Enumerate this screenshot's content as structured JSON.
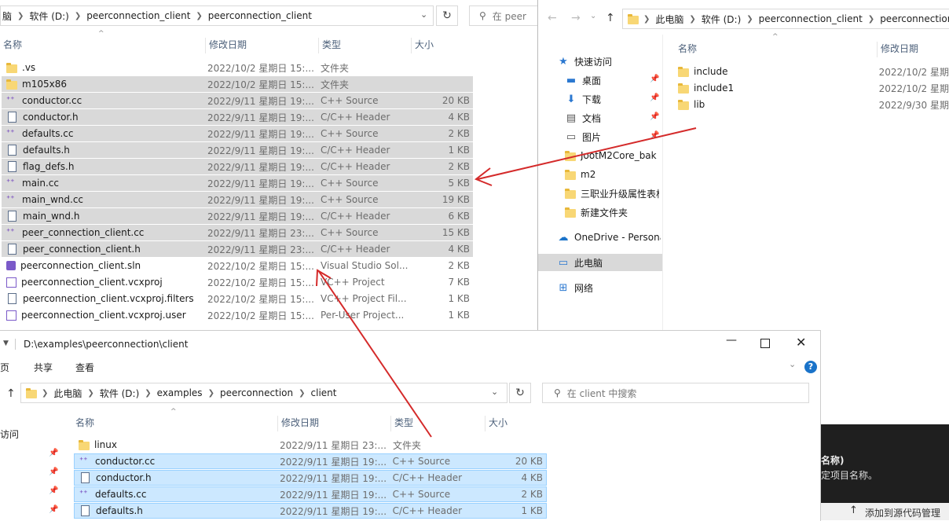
{
  "explorer_main": {
    "breadcrumb": [
      "脑",
      "软件 (D:)",
      "peerconnection_client",
      "peerconnection_client"
    ],
    "search_placeholder": "在 peer",
    "columns": {
      "name": "名称",
      "date": "修改日期",
      "type": "类型",
      "size": "大小"
    },
    "rows": [
      {
        "icon": "folder-icon",
        "name": ".vs",
        "date": "2022/10/2 星期日 15:...",
        "type": "文件夹",
        "size": "",
        "selected": false
      },
      {
        "icon": "folder-icon",
        "name": "m105x86",
        "date": "2022/10/2 星期日 15:...",
        "type": "文件夹",
        "size": "",
        "selected": true
      },
      {
        "icon": "cpp-source-icon",
        "name": "conductor.cc",
        "date": "2022/9/11 星期日 19:...",
        "type": "C++ Source",
        "size": "20 KB",
        "selected": true
      },
      {
        "icon": "header-file-icon",
        "name": "conductor.h",
        "date": "2022/9/11 星期日 19:...",
        "type": "C/C++ Header",
        "size": "4 KB",
        "selected": true
      },
      {
        "icon": "cpp-source-icon",
        "name": "defaults.cc",
        "date": "2022/9/11 星期日 19:...",
        "type": "C++ Source",
        "size": "2 KB",
        "selected": true
      },
      {
        "icon": "header-file-icon",
        "name": "defaults.h",
        "date": "2022/9/11 星期日 19:...",
        "type": "C/C++ Header",
        "size": "1 KB",
        "selected": true
      },
      {
        "icon": "header-file-icon",
        "name": "flag_defs.h",
        "date": "2022/9/11 星期日 19:...",
        "type": "C/C++ Header",
        "size": "2 KB",
        "selected": true
      },
      {
        "icon": "cpp-source-icon",
        "name": "main.cc",
        "date": "2022/9/11 星期日 19:...",
        "type": "C++ Source",
        "size": "5 KB",
        "selected": true
      },
      {
        "icon": "cpp-source-icon",
        "name": "main_wnd.cc",
        "date": "2022/9/11 星期日 19:...",
        "type": "C++ Source",
        "size": "19 KB",
        "selected": true
      },
      {
        "icon": "header-file-icon",
        "name": "main_wnd.h",
        "date": "2022/9/11 星期日 19:...",
        "type": "C/C++ Header",
        "size": "6 KB",
        "selected": true
      },
      {
        "icon": "cpp-source-icon",
        "name": "peer_connection_client.cc",
        "date": "2022/9/11 星期日 23:...",
        "type": "C++ Source",
        "size": "15 KB",
        "selected": true
      },
      {
        "icon": "header-file-icon",
        "name": "peer_connection_client.h",
        "date": "2022/9/11 星期日 23:...",
        "type": "C/C++ Header",
        "size": "4 KB",
        "selected": true
      },
      {
        "icon": "solution-icon",
        "name": "peerconnection_client.sln",
        "date": "2022/10/2 星期日 15:...",
        "type": "Visual Studio Sol...",
        "size": "2 KB",
        "selected": false
      },
      {
        "icon": "project-icon",
        "name": "peerconnection_client.vcxproj",
        "date": "2022/10/2 星期日 15:...",
        "type": "VC++ Project",
        "size": "7 KB",
        "selected": false
      },
      {
        "icon": "filters-icon",
        "name": "peerconnection_client.vcxproj.filters",
        "date": "2022/10/2 星期日 15:...",
        "type": "VC++ Project Fil...",
        "size": "1 KB",
        "selected": false
      },
      {
        "icon": "project-icon",
        "name": "peerconnection_client.vcxproj.user",
        "date": "2022/10/2 星期日 15:...",
        "type": "Per-User Project...",
        "size": "1 KB",
        "selected": false
      }
    ]
  },
  "explorer_right": {
    "breadcrumb": [
      "此电脑",
      "软件 (D:)",
      "peerconnection_client",
      "peerconnection_"
    ],
    "columns": {
      "name": "名称",
      "date": "修改日期"
    },
    "nav": [
      {
        "icon": "star-icon",
        "label": "快速访问",
        "pinned": false
      },
      {
        "icon": "desktop-icon",
        "label": "桌面",
        "pinned": true
      },
      {
        "icon": "download-icon",
        "label": "下载",
        "pinned": true
      },
      {
        "icon": "documents-icon",
        "label": "文档",
        "pinned": true
      },
      {
        "icon": "pictures-icon",
        "label": "图片",
        "pinned": true
      },
      {
        "icon": "folder-icon",
        "label": "JootM2Core_bak",
        "pinned": false
      },
      {
        "icon": "folder-icon",
        "label": "m2",
        "pinned": false
      },
      {
        "icon": "folder-icon",
        "label": "三职业升级属性表格",
        "pinned": false
      },
      {
        "icon": "folder-icon",
        "label": "新建文件夹",
        "pinned": false
      },
      {
        "icon": "onedrive-icon",
        "label": "OneDrive - Personal",
        "pinned": false
      },
      {
        "icon": "computer-icon",
        "label": "此电脑",
        "pinned": false
      },
      {
        "icon": "network-icon",
        "label": "网络",
        "pinned": false
      }
    ],
    "rows": [
      {
        "name": "include",
        "date": "2022/10/2 星期"
      },
      {
        "name": "include1",
        "date": "2022/10/2 星期"
      },
      {
        "name": "lib",
        "date": "2022/9/30 星期"
      }
    ]
  },
  "explorer_bottom": {
    "title": "D:\\examples\\peerconnection\\client",
    "ribbon": [
      "页",
      "共享",
      "查看"
    ],
    "breadcrumb": [
      "此电脑",
      "软件 (D:)",
      "examples",
      "peerconnection",
      "client"
    ],
    "search_placeholder": "在 client 中搜索",
    "columns": {
      "name": "名称",
      "date": "修改日期",
      "type": "类型",
      "size": "大小"
    },
    "nav_label": "访问",
    "rows": [
      {
        "icon": "folder-icon",
        "name": "linux",
        "date": "2022/9/11 星期日 23:...",
        "type": "文件夹",
        "size": "",
        "selected": false
      },
      {
        "icon": "cpp-source-icon",
        "name": "conductor.cc",
        "date": "2022/9/11 星期日 19:...",
        "type": "C++ Source",
        "size": "20 KB",
        "selected": true
      },
      {
        "icon": "header-file-icon",
        "name": "conductor.h",
        "date": "2022/9/11 星期日 19:...",
        "type": "C/C++ Header",
        "size": "4 KB",
        "selected": true
      },
      {
        "icon": "cpp-source-icon",
        "name": "defaults.cc",
        "date": "2022/9/11 星期日 19:...",
        "type": "C++ Source",
        "size": "2 KB",
        "selected": true
      },
      {
        "icon": "header-file-icon",
        "name": "defaults.h",
        "date": "2022/9/11 星期日 19:...",
        "type": "C/C++ Header",
        "size": "1 KB",
        "selected": true
      }
    ]
  },
  "dark_panel": {
    "line1": "名称)",
    "line2": "定项目名称。",
    "status": "添加到源代码管理"
  },
  "colors": {
    "arrow": "#d42a2a",
    "selection_gray": "#d9d9d9",
    "selection_blue": "#cce8ff",
    "folder": "#f8d775"
  }
}
